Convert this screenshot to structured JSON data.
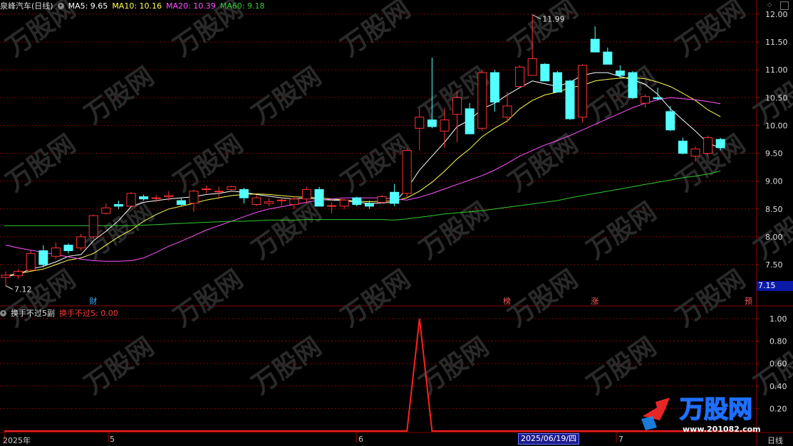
{
  "title": {
    "stock": "泉峰汽车(日线)",
    "ma5": "MA5: 9.65",
    "ma10": "MA10: 10.16",
    "ma20": "MA20: 10.39",
    "ma60": "MA60: 9.18"
  },
  "indicator": {
    "name": "换手不过5副",
    "value_label": "换手不过5: 0.00"
  },
  "labels": {
    "max_price": "11.99",
    "min_price": "7.12",
    "current_price": "7.15",
    "period": "日线",
    "selected_date": "2025/06/19/四",
    "x_ticks": [
      "2025年",
      "5",
      "6",
      "7"
    ],
    "markers": [
      "财",
      "榜",
      "涨",
      "预"
    ]
  },
  "watermark": {
    "brand": "万股网",
    "site": "www.201082.com"
  },
  "colors": {
    "up": "#ff3232",
    "down": "#54ffff",
    "ma5": "#ffffff",
    "ma10": "#ffff54",
    "ma20": "#ff55ff",
    "ma60": "#2ecc2e",
    "indicator": "#ff2020",
    "grid": "#8b0000"
  },
  "chart_data": [
    {
      "type": "candlestick",
      "y_ticks": [
        7.5,
        8.0,
        8.5,
        9.0,
        9.5,
        10.0,
        10.5,
        11.0,
        11.5,
        12.0
      ],
      "ylim": [
        7.04,
        12.05
      ],
      "ohlc": [
        [
          7.27,
          7.38,
          7.12,
          7.31
        ],
        [
          7.3,
          7.42,
          7.25,
          7.38
        ],
        [
          7.4,
          7.75,
          7.4,
          7.7
        ],
        [
          7.75,
          7.85,
          7.45,
          7.5
        ],
        [
          7.65,
          7.9,
          7.6,
          7.8
        ],
        [
          7.85,
          7.88,
          7.7,
          7.75
        ],
        [
          7.8,
          8.05,
          7.75,
          8.0
        ],
        [
          8.0,
          8.4,
          7.95,
          8.38
        ],
        [
          8.42,
          8.6,
          8.4,
          8.52
        ],
        [
          8.58,
          8.65,
          8.5,
          8.55
        ],
        [
          8.55,
          8.8,
          8.55,
          8.78
        ],
        [
          8.72,
          8.76,
          8.65,
          8.68
        ],
        [
          8.7,
          8.75,
          8.62,
          8.7
        ],
        [
          8.72,
          8.82,
          8.65,
          8.74
        ],
        [
          8.65,
          8.7,
          8.55,
          8.58
        ],
        [
          8.6,
          8.85,
          8.45,
          8.82
        ],
        [
          8.86,
          8.92,
          8.78,
          8.86
        ],
        [
          8.82,
          8.9,
          8.68,
          8.82
        ],
        [
          8.85,
          8.92,
          8.8,
          8.9
        ],
        [
          8.85,
          8.88,
          8.6,
          8.7
        ],
        [
          8.58,
          8.75,
          8.55,
          8.7
        ],
        [
          8.6,
          8.7,
          8.55,
          8.63
        ],
        [
          8.65,
          8.7,
          8.55,
          8.66
        ],
        [
          8.58,
          8.72,
          8.5,
          8.68
        ],
        [
          8.68,
          8.9,
          8.6,
          8.85
        ],
        [
          8.85,
          8.9,
          8.55,
          8.55
        ],
        [
          8.56,
          8.62,
          8.42,
          8.56
        ],
        [
          8.55,
          8.68,
          8.5,
          8.66
        ],
        [
          8.7,
          8.72,
          8.55,
          8.58
        ],
        [
          8.6,
          8.65,
          8.5,
          8.55
        ],
        [
          8.62,
          8.75,
          8.6,
          8.72
        ],
        [
          8.8,
          8.95,
          8.55,
          8.6
        ],
        [
          8.78,
          9.6,
          8.7,
          9.55
        ],
        [
          9.95,
          10.3,
          9.55,
          10.15
        ],
        [
          10.1,
          11.22,
          9.95,
          9.98
        ],
        [
          9.9,
          10.32,
          9.6,
          10.1
        ],
        [
          10.2,
          10.62,
          9.7,
          10.5
        ],
        [
          10.3,
          10.4,
          9.85,
          9.85
        ],
        [
          9.95,
          11.0,
          9.9,
          10.95
        ],
        [
          10.95,
          11.0,
          10.25,
          10.42
        ],
        [
          10.15,
          10.6,
          10.05,
          10.35
        ],
        [
          10.7,
          11.08,
          10.7,
          11.05
        ],
        [
          10.9,
          11.99,
          10.9,
          11.2
        ],
        [
          11.1,
          11.12,
          10.8,
          10.8
        ],
        [
          10.95,
          10.98,
          10.6,
          10.6
        ],
        [
          10.8,
          10.82,
          10.1,
          10.12
        ],
        [
          10.15,
          11.1,
          10.05,
          11.08
        ],
        [
          11.55,
          11.78,
          11.32,
          11.32
        ],
        [
          11.32,
          11.4,
          11.1,
          11.1
        ],
        [
          10.98,
          11.08,
          10.85,
          10.9
        ],
        [
          10.95,
          10.98,
          10.48,
          10.5
        ],
        [
          10.4,
          10.56,
          10.32,
          10.52
        ],
        [
          10.5,
          10.68,
          10.45,
          10.48
        ],
        [
          10.25,
          10.35,
          9.9,
          9.92
        ],
        [
          9.72,
          9.78,
          9.48,
          9.5
        ],
        [
          9.45,
          9.62,
          9.35,
          9.58
        ],
        [
          9.5,
          9.82,
          9.45,
          9.78
        ],
        [
          9.75,
          9.78,
          9.55,
          9.6
        ]
      ],
      "series": [
        {
          "name": "MA5",
          "values": [
            7.28,
            7.33,
            7.42,
            7.47,
            7.55,
            7.65,
            7.68,
            7.93,
            8.1,
            8.29,
            8.54,
            8.62,
            8.65,
            8.68,
            8.7,
            8.72,
            8.76,
            8.78,
            8.82,
            8.8,
            8.76,
            8.73,
            8.7,
            8.68,
            8.7,
            8.67,
            8.66,
            8.65,
            8.62,
            8.6,
            8.61,
            8.62,
            8.86,
            9.2,
            9.45,
            9.7,
            9.98,
            10.1,
            10.3,
            10.4,
            10.55,
            10.68,
            10.8,
            10.75,
            10.7,
            10.78,
            10.9,
            10.95,
            10.95,
            10.88,
            10.82,
            10.74,
            10.56,
            10.3,
            10.1,
            9.9,
            9.68,
            9.6
          ]
        },
        {
          "name": "MA10",
          "values": [
            7.3,
            7.34,
            7.38,
            7.42,
            7.5,
            7.58,
            7.62,
            7.7,
            7.85,
            8.0,
            8.12,
            8.28,
            8.4,
            8.5,
            8.55,
            8.6,
            8.66,
            8.7,
            8.74,
            8.76,
            8.77,
            8.76,
            8.74,
            8.72,
            8.71,
            8.7,
            8.68,
            8.66,
            8.64,
            8.63,
            8.64,
            8.64,
            8.7,
            8.82,
            8.98,
            9.18,
            9.4,
            9.58,
            9.8,
            9.95,
            10.08,
            10.3,
            10.45,
            10.55,
            10.6,
            10.68,
            10.72,
            10.8,
            10.83,
            10.85,
            10.86,
            10.84,
            10.78,
            10.7,
            10.58,
            10.45,
            10.28,
            10.16
          ]
        },
        {
          "name": "MA20",
          "values": [
            7.85,
            7.8,
            7.76,
            7.72,
            7.68,
            7.64,
            7.6,
            7.57,
            7.56,
            7.56,
            7.57,
            7.62,
            7.72,
            7.83,
            7.92,
            8.02,
            8.12,
            8.2,
            8.28,
            8.36,
            8.44,
            8.5,
            8.54,
            8.58,
            8.62,
            8.66,
            8.68,
            8.7,
            8.7,
            8.7,
            8.7,
            8.68,
            8.66,
            8.71,
            8.78,
            8.86,
            8.94,
            9.02,
            9.1,
            9.2,
            9.32,
            9.45,
            9.55,
            9.65,
            9.73,
            9.82,
            9.92,
            10.02,
            10.12,
            10.22,
            10.32,
            10.4,
            10.46,
            10.5,
            10.48,
            10.46,
            10.43,
            10.39
          ]
        },
        {
          "name": "MA60",
          "values": [
            8.2,
            8.2,
            8.2,
            8.2,
            8.2,
            8.2,
            8.2,
            8.2,
            8.2,
            8.2,
            8.2,
            8.21,
            8.22,
            8.23,
            8.24,
            8.25,
            8.26,
            8.27,
            8.28,
            8.28,
            8.29,
            8.3,
            8.3,
            8.3,
            8.31,
            8.31,
            8.31,
            8.31,
            8.31,
            8.31,
            8.31,
            8.3,
            8.32,
            8.35,
            8.38,
            8.41,
            8.43,
            8.45,
            8.47,
            8.5,
            8.53,
            8.56,
            8.59,
            8.62,
            8.65,
            8.7,
            8.74,
            8.78,
            8.82,
            8.86,
            8.9,
            8.94,
            8.98,
            9.02,
            9.06,
            9.09,
            9.13,
            9.18
          ]
        }
      ]
    },
    {
      "type": "line",
      "y_ticks": [
        0.0,
        0.2,
        0.4,
        0.6,
        0.8,
        1.0
      ],
      "ylim": [
        0.0,
        1.05
      ],
      "series": [
        {
          "name": "换手不过5",
          "values": [
            0,
            0,
            0,
            0,
            0,
            0,
            0,
            0,
            0,
            0,
            0,
            0,
            0,
            0,
            0,
            0,
            0,
            0,
            0,
            0,
            0,
            0,
            0,
            0,
            0,
            0,
            0,
            0,
            0,
            0,
            0,
            0,
            0,
            1,
            0,
            0,
            0,
            0,
            0,
            0,
            0,
            0,
            0,
            0,
            0,
            0,
            0,
            0,
            0,
            0,
            0,
            0,
            0,
            0,
            0,
            0,
            0,
            0
          ]
        }
      ]
    }
  ]
}
